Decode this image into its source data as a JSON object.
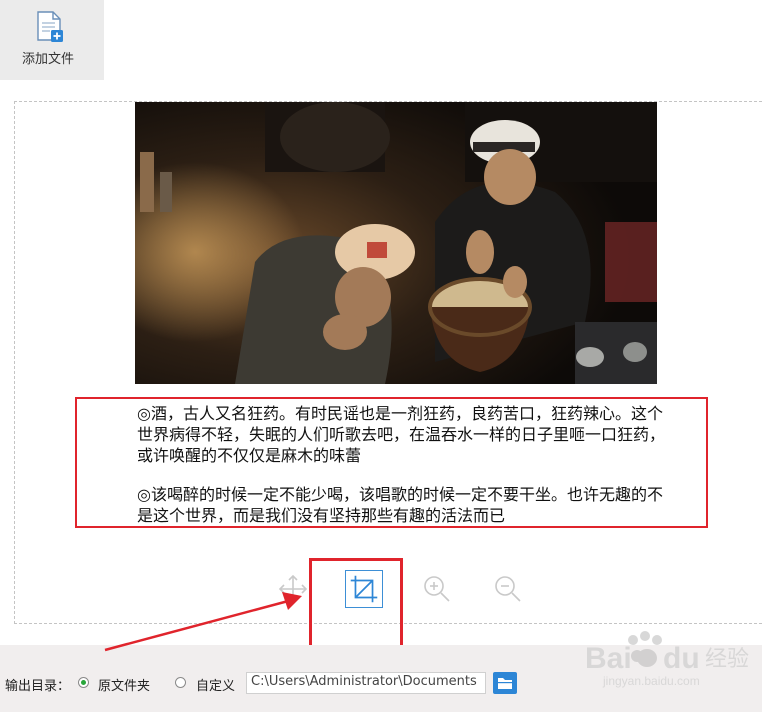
{
  "toolbar": {
    "add_file_label": "添加文件",
    "add_file_icon": "add-file-icon"
  },
  "content": {
    "photo_desc_icon": "photo",
    "text_lines": [
      "◎酒，古人又名狂药。有时民谣也是一剂狂药，良药苦口，狂药辣心。这个世界病得不轻，失眠的人们听歌去吧，在温吞水一样的日子里咂一口狂药，或许唤醒的不仅仅是麻木的味蕾",
      "◎该喝醉的时候一定不能少喝，该唱歌的时候一定不要干坐。也许无趣的不是这个世界，而是我们没有坚持那些有趣的活法而已"
    ]
  },
  "tools": [
    {
      "name": "move-icon",
      "selected": false
    },
    {
      "name": "crop-icon",
      "selected": true
    },
    {
      "name": "zoom-in-icon",
      "selected": false
    },
    {
      "name": "zoom-out-icon",
      "selected": false
    }
  ],
  "output": {
    "label": "输出目录：",
    "option_original": "原文件夹",
    "option_custom": "自定义",
    "selected": "原文件夹",
    "path_value": "C:\\Users\\Administrator\\Documents",
    "folder_icon": "folder-icon"
  },
  "watermark": {
    "brand": "Baidu经验",
    "url": "jingyan.baidu.com"
  },
  "colors": {
    "highlight": "#e0242c",
    "accent_blue": "#2d86d6",
    "radio_green": "#29a63a"
  }
}
